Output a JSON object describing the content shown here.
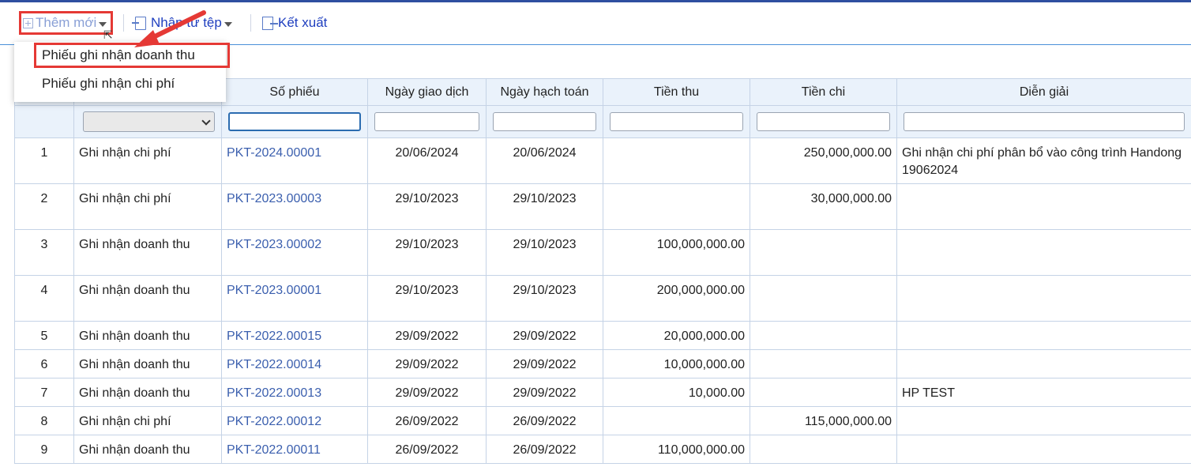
{
  "toolbar": {
    "add_label": "Thêm mới",
    "import_label": "Nhập từ tệp",
    "export_label": "Kết xuất"
  },
  "menu": {
    "items": [
      {
        "label": "Phiếu ghi nhận doanh thu"
      },
      {
        "label": "Phiếu ghi nhận chi phí"
      }
    ]
  },
  "colors": {
    "highlight": "#e53935",
    "link": "#3b5fae",
    "header_bg": "#eaf2fb"
  },
  "table": {
    "headers": [
      "",
      "",
      "Số phiếu",
      "Ngày giao dịch",
      "Ngày hạch toán",
      "Tiền thu",
      "Tiền chi",
      "Diễn giải"
    ],
    "rows": [
      {
        "stt": "1",
        "loai": "Ghi nhận chi phí",
        "so": "PKT-2024.00001",
        "ngay_gd": "20/06/2024",
        "ngay_ht": "20/06/2024",
        "thu": "",
        "chi": "250,000,000.00",
        "dien_giai": "Ghi nhận chi phí phân bổ vào công trình Handong 19062024"
      },
      {
        "stt": "2",
        "loai": "Ghi nhận chi phí",
        "so": "PKT-2023.00003",
        "ngay_gd": "29/10/2023",
        "ngay_ht": "29/10/2023",
        "thu": "",
        "chi": "30,000,000.00",
        "dien_giai": ""
      },
      {
        "stt": "3",
        "loai": "Ghi nhận doanh thu",
        "so": "PKT-2023.00002",
        "ngay_gd": "29/10/2023",
        "ngay_ht": "29/10/2023",
        "thu": "100,000,000.00",
        "chi": "",
        "dien_giai": ""
      },
      {
        "stt": "4",
        "loai": "Ghi nhận doanh thu",
        "so": "PKT-2023.00001",
        "ngay_gd": "29/10/2023",
        "ngay_ht": "29/10/2023",
        "thu": "200,000,000.00",
        "chi": "",
        "dien_giai": ""
      },
      {
        "stt": "5",
        "loai": "Ghi nhận doanh thu",
        "so": "PKT-2022.00015",
        "ngay_gd": "29/09/2022",
        "ngay_ht": "29/09/2022",
        "thu": "20,000,000.00",
        "chi": "",
        "dien_giai": ""
      },
      {
        "stt": "6",
        "loai": "Ghi nhận doanh thu",
        "so": "PKT-2022.00014",
        "ngay_gd": "29/09/2022",
        "ngay_ht": "29/09/2022",
        "thu": "10,000,000.00",
        "chi": "",
        "dien_giai": ""
      },
      {
        "stt": "7",
        "loai": "Ghi nhận doanh thu",
        "so": "PKT-2022.00013",
        "ngay_gd": "29/09/2022",
        "ngay_ht": "29/09/2022",
        "thu": "10,000.00",
        "chi": "",
        "dien_giai": "HP TEST"
      },
      {
        "stt": "8",
        "loai": "Ghi nhận chi phí",
        "so": "PKT-2022.00012",
        "ngay_gd": "26/09/2022",
        "ngay_ht": "26/09/2022",
        "thu": "",
        "chi": "115,000,000.00",
        "dien_giai": ""
      },
      {
        "stt": "9",
        "loai": "Ghi nhận doanh thu",
        "so": "PKT-2022.00011",
        "ngay_gd": "26/09/2022",
        "ngay_ht": "26/09/2022",
        "thu": "110,000,000.00",
        "chi": "",
        "dien_giai": ""
      }
    ]
  }
}
